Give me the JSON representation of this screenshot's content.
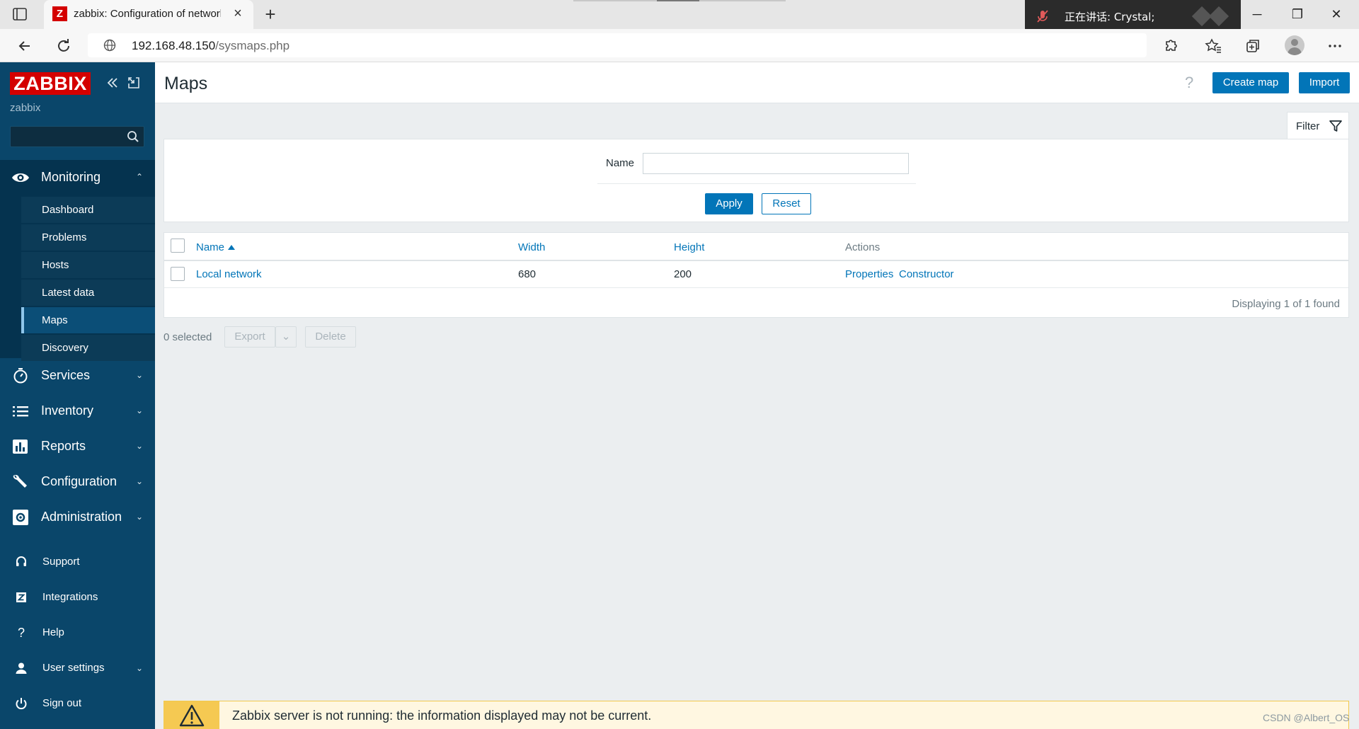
{
  "browser": {
    "tab_title": "zabbix: Configuration of network maps",
    "tab_favicon": "Z",
    "url_host": "192.168.48.150",
    "url_path": "/sysmaps.php",
    "talk_indicator": "正在讲话: Crystal;"
  },
  "sidebar": {
    "logo": "ZABBIX",
    "user": "zabbix",
    "search_placeholder": "",
    "monitoring": {
      "label": "Monitoring",
      "items": [
        "Dashboard",
        "Problems",
        "Hosts",
        "Latest data",
        "Maps",
        "Discovery"
      ],
      "active": "Maps"
    },
    "sections": [
      "Services",
      "Inventory",
      "Reports",
      "Configuration",
      "Administration"
    ],
    "footer": {
      "support": "Support",
      "integrations": "Integrations",
      "help": "Help",
      "user_settings": "User settings",
      "sign_out": "Sign out"
    }
  },
  "header": {
    "title": "Maps",
    "help": "?",
    "create_map": "Create map",
    "import": "Import"
  },
  "filter": {
    "tab_label": "Filter",
    "name_label": "Name",
    "name_value": "",
    "apply": "Apply",
    "reset": "Reset"
  },
  "table": {
    "columns": {
      "name": "Name",
      "width": "Width",
      "height": "Height",
      "actions": "Actions"
    },
    "rows": [
      {
        "name": "Local network",
        "width": "680",
        "height": "200",
        "action_properties": "Properties",
        "action_constructor": "Constructor"
      }
    ],
    "paging": "Displaying 1 of 1 found"
  },
  "actionbar": {
    "selected": "0 selected",
    "export": "Export",
    "delete": "Delete"
  },
  "banner": {
    "message": "Zabbix server is not running: the information displayed may not be current."
  },
  "watermark": "CSDN @Albert_OS",
  "colors": {
    "sidebar": "#0a466a",
    "accent": "#0275b8",
    "logo": "#d40000",
    "warning": "#f5c952"
  }
}
